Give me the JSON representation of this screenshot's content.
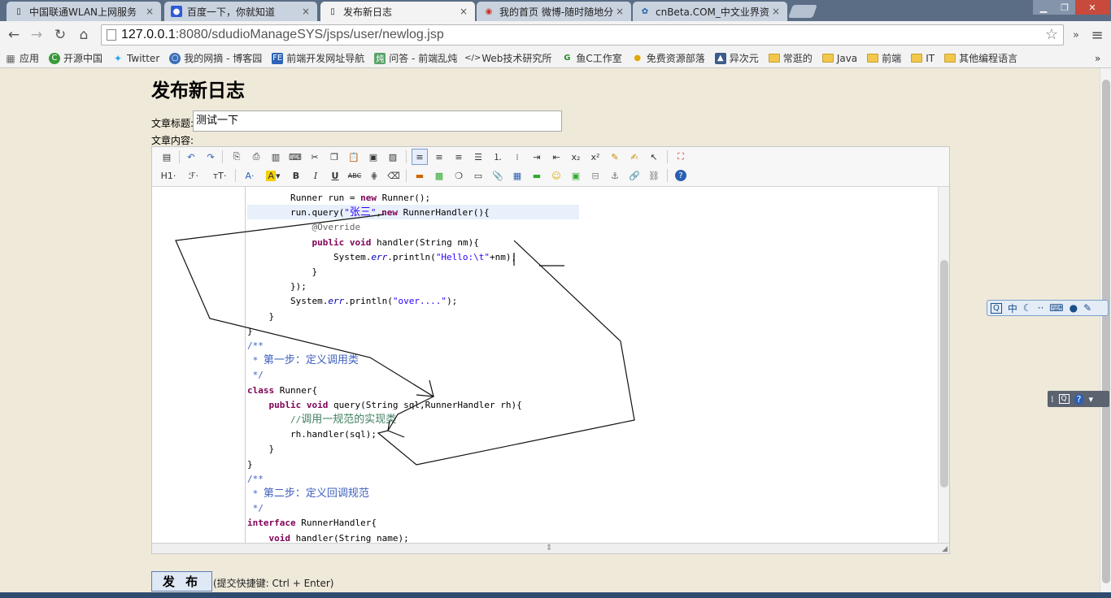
{
  "browser": {
    "tabs": [
      {
        "title": "中国联通WLAN上网服务",
        "active": false,
        "icon": "document-icon"
      },
      {
        "title": "百度一下，你就知道",
        "active": false,
        "icon": "baidu-paw-icon"
      },
      {
        "title": "发布新日志",
        "active": true,
        "icon": "document-icon"
      },
      {
        "title": "我的首页 微博-随时随地分",
        "active": false,
        "icon": "weibo-icon"
      },
      {
        "title": "cnBeta.COM_中文业界资",
        "active": false,
        "icon": "cnbeta-icon"
      }
    ],
    "url_host": "127.0.0.1",
    "url_rest": ":8080/sdudioManageSYS/jsps/user/newlog.jsp",
    "bookmarks": [
      {
        "label": "应用",
        "icon": "apps-grid-icon"
      },
      {
        "label": "开源中国",
        "icon": "oschina-icon"
      },
      {
        "label": "Twitter",
        "icon": "twitter-icon"
      },
      {
        "label": "我的网摘 - 博客园",
        "icon": "cnblogs-icon"
      },
      {
        "label": "前端开发网址导航",
        "icon": "fe-icon"
      },
      {
        "label": "问答 - 前端乱炖",
        "icon": "luandun-icon"
      },
      {
        "label": "Web技术研究所",
        "icon": "code-icon"
      },
      {
        "label": "鱼C工作室",
        "icon": "fishc-icon"
      },
      {
        "label": "免费资源部落",
        "icon": "bulb-icon"
      },
      {
        "label": "异次元",
        "icon": "image-icon"
      },
      {
        "label": "常逛的",
        "icon": "folder-icon"
      },
      {
        "label": "Java",
        "icon": "folder-icon"
      },
      {
        "label": "前端",
        "icon": "folder-icon"
      },
      {
        "label": "IT",
        "icon": "folder-icon"
      },
      {
        "label": "其他编程语言",
        "icon": "folder-icon"
      }
    ],
    "more_label": "»"
  },
  "page": {
    "title": "发布新日志",
    "title_label": "文章标题:",
    "title_value": "测试一下",
    "content_label": "文章内容:",
    "toolbar_row2_labels": {
      "heading": "H1·",
      "font": "ℱ·",
      "size": "тT·",
      "color": "A·",
      "bold": "B",
      "italic": "I",
      "underline": "U",
      "strike": "ABC"
    },
    "submit_label": "发 布",
    "hint": "(提交快捷键: Ctrl + Enter)"
  },
  "code_lines": [
    {
      "indent": "        ",
      "html": "Runner run = <span class='kw'>new</span> Runner();"
    },
    {
      "indent": "        ",
      "html": "run.query(<span class='str'>\"<span class='cn'>张三</span>\"</span>,<span class='kw'>new</span> RunnerHandler(){"
    },
    {
      "indent": "            ",
      "html": "<span class='ann'>@Override</span>"
    },
    {
      "indent": "            ",
      "html": "<span class='kw'>public</span> <span class='kw'>void</span> handler(String nm){"
    },
    {
      "indent": "                ",
      "html": "System.<span class='it'>err</span>.println(<span class='str'>\"Hello:\\t\"</span>+nm);"
    },
    {
      "indent": "            ",
      "html": "}"
    },
    {
      "indent": "        ",
      "html": "});"
    },
    {
      "indent": "        ",
      "html": "System.<span class='it'>err</span>.println(<span class='str'>\"over....\"</span>);"
    },
    {
      "indent": "    ",
      "html": "}"
    },
    {
      "indent": "",
      "html": "}"
    },
    {
      "indent": "",
      "html": "<span class='cm'>/**</span>"
    },
    {
      "indent": "",
      "html": "<span class='cm'> * <span class='cn'>第一步：定义调用类</span></span>"
    },
    {
      "indent": "",
      "html": "<span class='cm'> */</span>"
    },
    {
      "indent": "",
      "html": "<span class='kw'>class</span> Runner{"
    },
    {
      "indent": "    ",
      "html": "<span class='kw'>public</span> <span class='kw'>void</span> query(String sql,RunnerHandler rh){"
    },
    {
      "indent": "        ",
      "html": "<span class='cmg'>//<span class='cn'>调用一规范的实现类</span></span>"
    },
    {
      "indent": "        ",
      "html": "rh.handler(sql);"
    },
    {
      "indent": "    ",
      "html": "}"
    },
    {
      "indent": "",
      "html": "}"
    },
    {
      "indent": "",
      "html": "<span class='cm'>/**</span>"
    },
    {
      "indent": "",
      "html": "<span class='cm'> * <span class='cn'>第二步：定义回调规范</span></span>"
    },
    {
      "indent": "",
      "html": "<span class='cm'> */</span>"
    },
    {
      "indent": "",
      "html": "<span class='kw'>interface</span> RunnerHandler{"
    },
    {
      "indent": "    ",
      "html": "<span class='kw'>void</span> handler(String name);"
    }
  ],
  "ime": {
    "lang": "中"
  },
  "colors": {
    "accent": "#7f0055",
    "string": "#2a00ff",
    "comment": "#3f5fbf",
    "page_bg": "#efe9d9"
  }
}
